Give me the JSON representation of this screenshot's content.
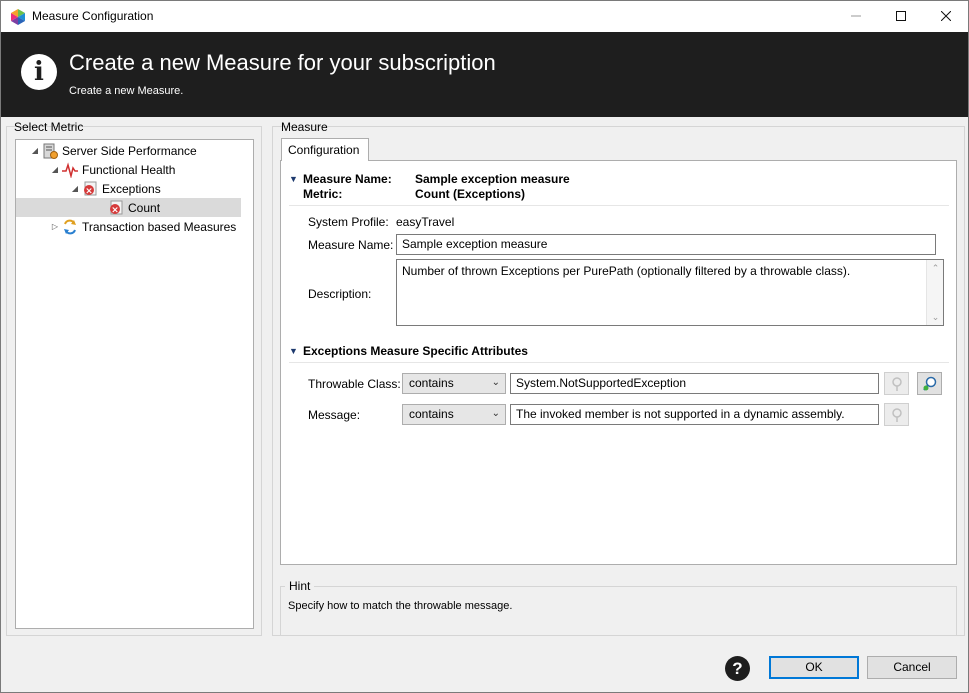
{
  "window": {
    "title": "Measure Configuration"
  },
  "banner": {
    "title": "Create a new Measure for your subscription",
    "subtitle": "Create a new Measure."
  },
  "left_panel": {
    "group_label": "Select Metric",
    "tree": [
      {
        "label": "Server Side Performance",
        "icon": "server-icon",
        "expanded": true,
        "selected": false
      },
      {
        "label": "Functional Health",
        "icon": "pulse-icon",
        "expanded": true,
        "selected": false
      },
      {
        "label": "Exceptions",
        "icon": "exception-icon",
        "expanded": true,
        "selected": false
      },
      {
        "label": "Count",
        "icon": "exception-icon",
        "expanded": false,
        "selected": true
      },
      {
        "label": "Transaction based Measures",
        "icon": "transaction-icon",
        "expanded": false,
        "selected": false
      }
    ]
  },
  "right_panel": {
    "group_label": "Measure",
    "tab_label": "Configuration",
    "summary": {
      "measure_name_label": "Measure Name:",
      "measure_name_value": "Sample exception measure",
      "metric_label": "Metric:",
      "metric_value": "Count (Exceptions)"
    },
    "form": {
      "system_profile_label": "System Profile:",
      "system_profile_value": "easyTravel",
      "measure_name_label": "Measure Name:",
      "measure_name_value": "Sample exception measure",
      "description_label": "Description:",
      "description_value": "Number of thrown Exceptions per PurePath (optionally filtered by a throwable class)."
    },
    "specific": {
      "heading": "Exceptions Measure Specific Attributes",
      "throwable_label": "Throwable Class:",
      "throwable_operator": "contains",
      "throwable_value": "System.NotSupportedException",
      "message_label": "Message:",
      "message_operator": "contains",
      "message_value": "The invoked member is not supported in a dynamic assembly."
    }
  },
  "hint": {
    "label": "Hint",
    "text": "Specify how to match the throwable message."
  },
  "footer": {
    "help_glyph": "?",
    "ok_label": "OK",
    "cancel_label": "Cancel"
  },
  "colors": {
    "banner_bg": "#1e1e1e",
    "accent_blue": "#0078d7",
    "selection": "#dadada"
  }
}
